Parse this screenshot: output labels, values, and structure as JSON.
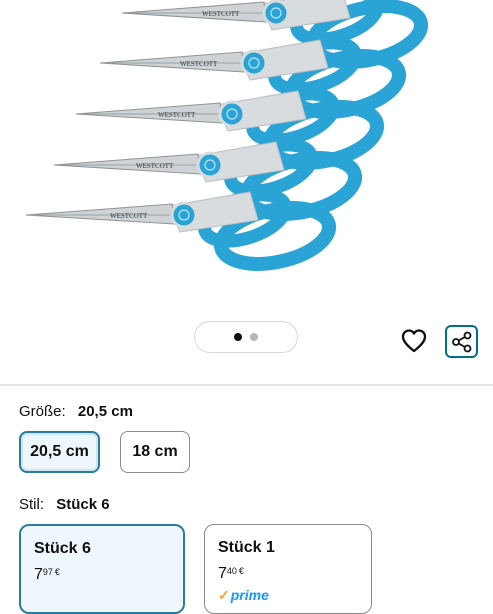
{
  "image_gallery": {
    "brand_text": "WESTCOTT",
    "active_index": 0,
    "total": 2
  },
  "actions": {
    "wishlist_icon": "heart-icon",
    "share_icon": "share-icon"
  },
  "size": {
    "label": "Größe:",
    "selected_value": "20,5 cm",
    "options": [
      "20,5 cm",
      "18 cm"
    ]
  },
  "style": {
    "label": "Stil:",
    "selected_value": "Stück 6",
    "options": [
      {
        "title": "Stück 6",
        "price_whole": "7",
        "price_fraction": "97",
        "currency": "€",
        "prime": false
      },
      {
        "title": "Stück 1",
        "price_whole": "7",
        "price_fraction": "40",
        "currency": "€",
        "prime": true,
        "prime_label": "prime"
      }
    ]
  },
  "colors": {
    "accent": "#2b7aa1",
    "share_border": "#007185",
    "scissor_handle": "#2aa3d6",
    "prime_blue": "#1a98ff"
  }
}
